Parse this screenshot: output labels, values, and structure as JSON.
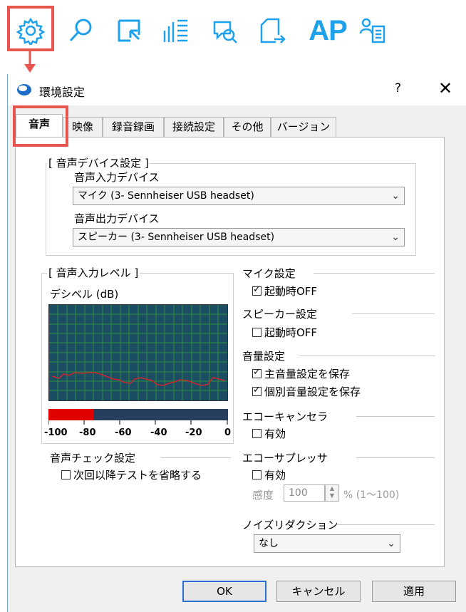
{
  "toolbar": {
    "icons": [
      "gear-icon",
      "search-icon",
      "screen-select-icon",
      "list-icon",
      "chat-search-icon",
      "export-icon",
      "ap-icon",
      "user-list-icon"
    ],
    "ap_label": "AP",
    "accent_color": "#1ea0ea",
    "highlight_color": "#e8554e"
  },
  "dialog": {
    "title": "環境設定",
    "help_label": "?",
    "close_label": "✕",
    "tabs": [
      "音声",
      "映像",
      "録音録画",
      "接続設定",
      "その他",
      "バージョン"
    ],
    "active_tab": "音声"
  },
  "device": {
    "group_label": "[ 音声デバイス設定 ]",
    "input_label": "音声入力デバイス",
    "input_value": "マイク (3- Sennheiser USB headset)",
    "output_label": "音声出力デバイス",
    "output_value": "スピーカー (3- Sennheiser USB headset)"
  },
  "level": {
    "group_label": "[ 音声入力レベル ]",
    "db_label": "デシベル (dB)",
    "meter_fill": 0.25,
    "scale": [
      "-100",
      "-80",
      "-60",
      "-40",
      "-20",
      "0"
    ]
  },
  "check": {
    "label": "音声チェック設定",
    "skip_test": "次回以降テストを省略する",
    "skip_test_checked": false
  },
  "mic": {
    "label": "マイク設定",
    "off_on_start": "起動時OFF",
    "off_on_start_checked": true
  },
  "speaker": {
    "label": "スピーカー設定",
    "off_on_start": "起動時OFF",
    "off_on_start_checked": false
  },
  "volume": {
    "label": "音量設定",
    "save_master": "主音量設定を保存",
    "save_master_checked": true,
    "save_individual": "個別音量設定を保存",
    "save_individual_checked": true
  },
  "echo_cancel": {
    "label": "エコーキャンセラ",
    "enabled": "有効",
    "enabled_checked": false
  },
  "echo_suppress": {
    "label": "エコーサプレッサ",
    "enabled": "有効",
    "enabled_checked": false,
    "sensitivity_label": "感度",
    "sensitivity_value": "100",
    "sensitivity_range": "% (1～100)"
  },
  "noise": {
    "label": "ノイズリダクション",
    "value": "なし"
  },
  "buttons": {
    "ok": "OK",
    "cancel": "キャンセル",
    "apply": "適用"
  }
}
